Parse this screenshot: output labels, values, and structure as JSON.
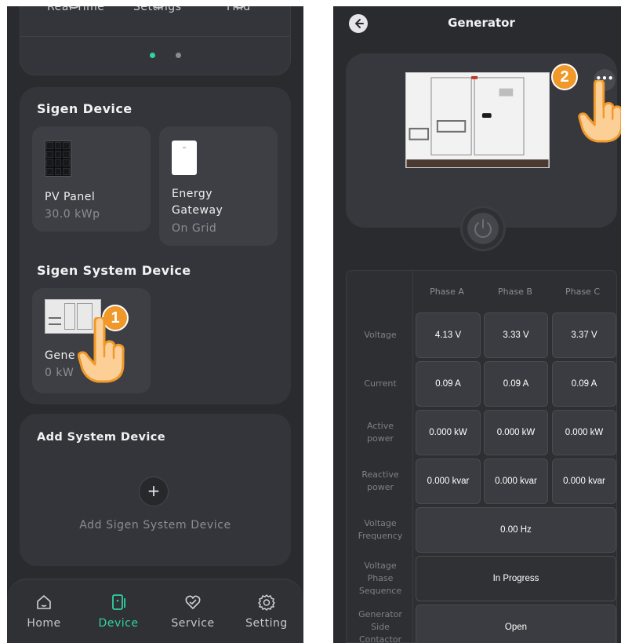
{
  "left_screen": {
    "quick_actions": [
      {
        "label": "Real Time",
        "icon": "realtime-icon"
      },
      {
        "label": "Settings",
        "icon": "settings-icon"
      },
      {
        "label": "Find",
        "icon": "find-icon"
      }
    ],
    "sigen_device": {
      "title": "Sigen Device",
      "devices": [
        {
          "name": "PV Panel",
          "value": "30.0 kWp",
          "icon": "pv-panel-image"
        },
        {
          "name": "Energy Gateway",
          "value": "On Grid",
          "icon": "energy-gateway-image"
        }
      ]
    },
    "system_device": {
      "title": "Sigen System Device",
      "device": {
        "name": "Gene",
        "value": "0 kW",
        "icon": "generator-image"
      }
    },
    "add_system": {
      "title": "Add System Device",
      "button_symbol": "+",
      "label": "Add Sigen System Device"
    },
    "nav": [
      {
        "label": "Home",
        "icon": "home-icon"
      },
      {
        "label": "Device",
        "icon": "device-icon",
        "active": true
      },
      {
        "label": "Service",
        "icon": "service-icon"
      },
      {
        "label": "Setting",
        "icon": "setting-icon"
      }
    ],
    "step_badge": "1",
    "accent_color": "#2fd3a5"
  },
  "right_screen": {
    "title": "Generator",
    "more_label": "•••",
    "step_badge": "2",
    "table": {
      "headers": [
        "Phase A",
        "Phase B",
        "Phase C"
      ],
      "rows": [
        {
          "label": "Voltage",
          "values": [
            "4.13 V",
            "3.33 V",
            "3.37 V"
          ]
        },
        {
          "label": "Current",
          "values": [
            "0.09 A",
            "0.09 A",
            "0.09 A"
          ]
        },
        {
          "label": "Active power",
          "values": [
            "0.000 kW",
            "0.000 kW",
            "0.000 kW"
          ]
        },
        {
          "label": "Reactive power",
          "values": [
            "0.000 kvar",
            "0.000 kvar",
            "0.000 kvar"
          ]
        },
        {
          "label": "Voltage Frequency",
          "value": "0.00 Hz"
        },
        {
          "label": "Voltage Phase Sequence",
          "value": "In Progress"
        },
        {
          "label": "Generator Side Contactor",
          "value": "Open"
        }
      ]
    }
  },
  "colors": {
    "badge": "#f0982a",
    "background": "#2a2b2f",
    "card": "#34353a"
  }
}
